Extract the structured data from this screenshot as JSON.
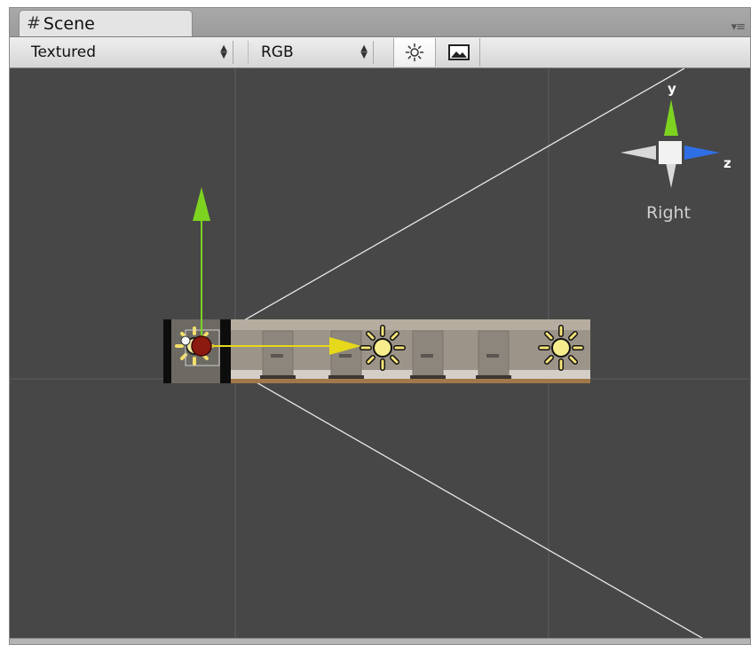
{
  "tab": {
    "icon": "grid-hash-icon",
    "title": "Scene"
  },
  "toolbar": {
    "draw_mode": "Textured",
    "render_mode": "RGB",
    "lighting_icon": "sun-icon",
    "fx_icon": "image-icon"
  },
  "gizmo": {
    "axis_y": "y",
    "axis_z": "z",
    "view_label": "Right"
  },
  "colors": {
    "viewport_bg": "#474747",
    "axis_y": "#7ed321",
    "axis_x": "#e6d81a",
    "axis_z": "#2f6fe6"
  }
}
